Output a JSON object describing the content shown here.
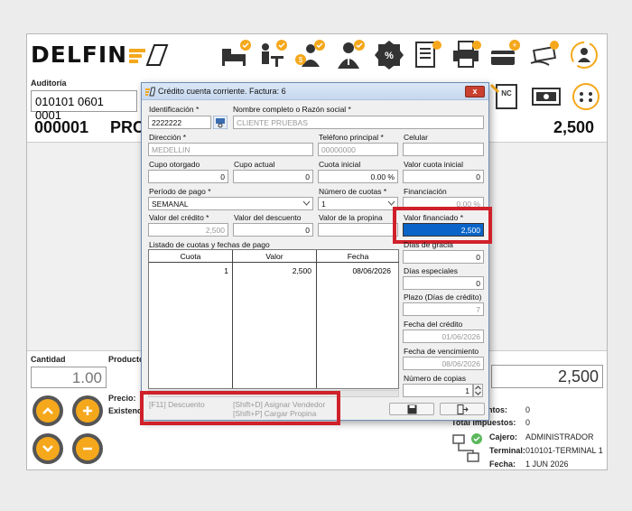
{
  "app": {
    "logo_text": "DELFIN",
    "auditoria_label": "Auditoría",
    "auditoria_value": "010101 0601 0001",
    "item_code": "000001",
    "product_partial": "PRC",
    "total_top": "2,500",
    "cantidad_label": "Cantidad",
    "producto_label": "Producto",
    "cantidad_value": "1.00",
    "precio_label": "Precio:",
    "existencia_label": "Existencia:",
    "price_big": "2,500",
    "descuentos_label": "ntos:",
    "descuentos_value": "0",
    "total_impuestos_label": "Total impuestos:",
    "total_impuestos_value": "0",
    "cajero_label": "Cajero:",
    "cajero_value": "ADMINISTRADOR",
    "terminal_label": "Terminal:",
    "terminal_value": "010101-TERMINAL 1",
    "fecha_label": "Fecha:",
    "fecha_value": "1 JUN 2026"
  },
  "dialog": {
    "title": "Crédito cuenta corriente. Factura: 6",
    "close": "x",
    "identificacion_label": "Identificación *",
    "identificacion_value": "2222222",
    "nombre_label": "Nombre completo o Razón social *",
    "nombre_value": "CLIENTE PRUEBAS",
    "direccion_label": "Dirección *",
    "direccion_value": "MEDELLIN",
    "telefono_label": "Teléfono principal *",
    "telefono_value": "00000000",
    "celular_label": "Celular",
    "celular_value": "",
    "cupo_otorgado_label": "Cupo otorgado",
    "cupo_otorgado_value": "0",
    "cupo_actual_label": "Cupo actual",
    "cupo_actual_value": "0",
    "cuota_inicial_label": "Cuota inicial",
    "cuota_inicial_value": "0.00 %",
    "valor_cuota_inicial_label": "Valor cuota inicial",
    "valor_cuota_inicial_value": "0",
    "periodo_label": "Período de pago *",
    "periodo_value": "SEMANAL",
    "num_cuotas_label": "Número de cuotas *",
    "num_cuotas_value": "1",
    "financiacion_label": "Financiación",
    "financiacion_value": "0.00 %",
    "valor_credito_label": "Valor del crédito *",
    "valor_credito_value": "2,500",
    "valor_descuento_label": "Valor del descuento",
    "valor_descuento_value": "0",
    "valor_propina_label": "Valor de la propina",
    "valor_propina_value": "",
    "valor_financiado_label": "Valor financiado *",
    "valor_financiado_value": "2,500",
    "listado_label": "Listado de cuotas y fechas de pago",
    "grid_headers": [
      "Cuota",
      "Valor",
      "Fecha"
    ],
    "grid_rows": [
      [
        "1",
        "2,500",
        "08/06/2026"
      ]
    ],
    "dias_gracia_label": "Días de gracia",
    "dias_gracia_value": "0",
    "dias_especiales_label": "Días especiales",
    "dias_especiales_value": "0",
    "plazo_label": "Plazo (Días de crédito)",
    "plazo_value": "7",
    "fecha_credito_label": "Fecha del crédito",
    "fecha_credito_value": "01/06/2026",
    "fecha_venc_label": "Fecha de vencimiento",
    "fecha_venc_value": "08/06/2026",
    "num_copias_label": "Número de copias",
    "num_copias_value": "1",
    "shortcut_f11": "[F11] Descuento",
    "shortcut_vendedor": "[Shift+D] Asignar Vendedor",
    "shortcut_propina": "[Shift+P] Cargar Propina"
  },
  "colors": {
    "accent": "#f5a81c",
    "highlight": "#d0202a",
    "selection": "#0a64c8"
  }
}
